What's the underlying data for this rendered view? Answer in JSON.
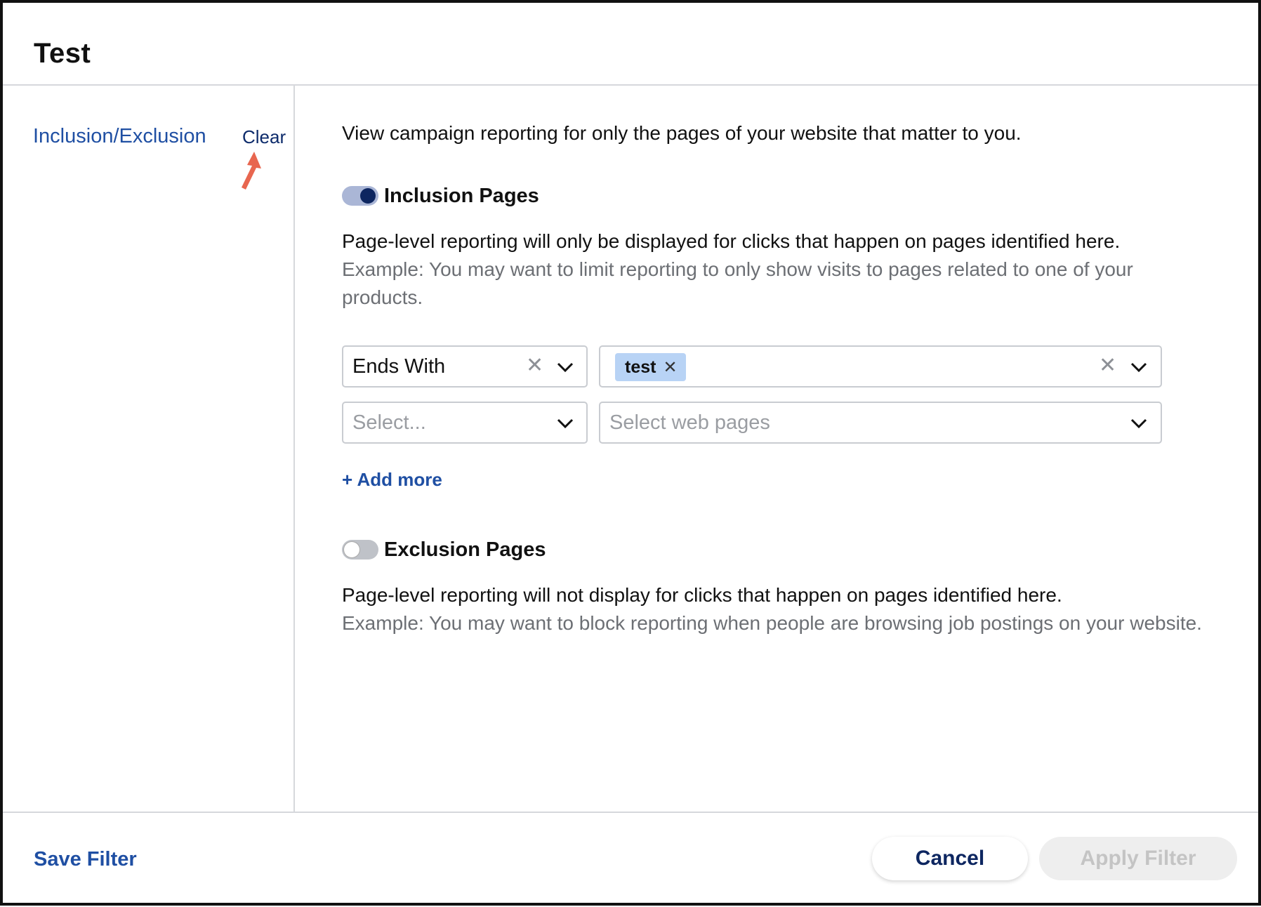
{
  "header": {
    "title": "Test"
  },
  "sidebar": {
    "link_label": "Inclusion/Exclusion",
    "clear_label": "Clear"
  },
  "main": {
    "intro": "View campaign reporting for only the pages of your website that matter to you.",
    "inclusion": {
      "label": "Inclusion Pages",
      "enabled": true,
      "description": "Page-level reporting will only be displayed for clicks that happen on pages identified here.",
      "example": "Example: You may want to limit reporting to only show visits to pages related to one of your products.",
      "rows": [
        {
          "operator": "Ends With",
          "chips": [
            "test"
          ]
        },
        {
          "operator_placeholder": "Select...",
          "pages_placeholder": "Select web pages"
        }
      ],
      "add_more_label": "+ Add more"
    },
    "exclusion": {
      "label": "Exclusion Pages",
      "enabled": false,
      "description": "Page-level reporting will not display for clicks that happen on pages identified here.",
      "example": "Example: You may want to block reporting when people are browsing job postings on your website."
    }
  },
  "footer": {
    "save_label": "Save Filter",
    "cancel_label": "Cancel",
    "apply_label": "Apply Filter",
    "apply_disabled": true
  },
  "colors": {
    "link": "#1f4fa3",
    "toggle_on_track": "#aab6d6",
    "toggle_on_knob": "#0d2660",
    "chip_bg": "#b8d3f5",
    "arrow": "#e8664f"
  },
  "icons": [
    "close-icon",
    "chevron-down-icon",
    "red-arrow-annotation"
  ]
}
